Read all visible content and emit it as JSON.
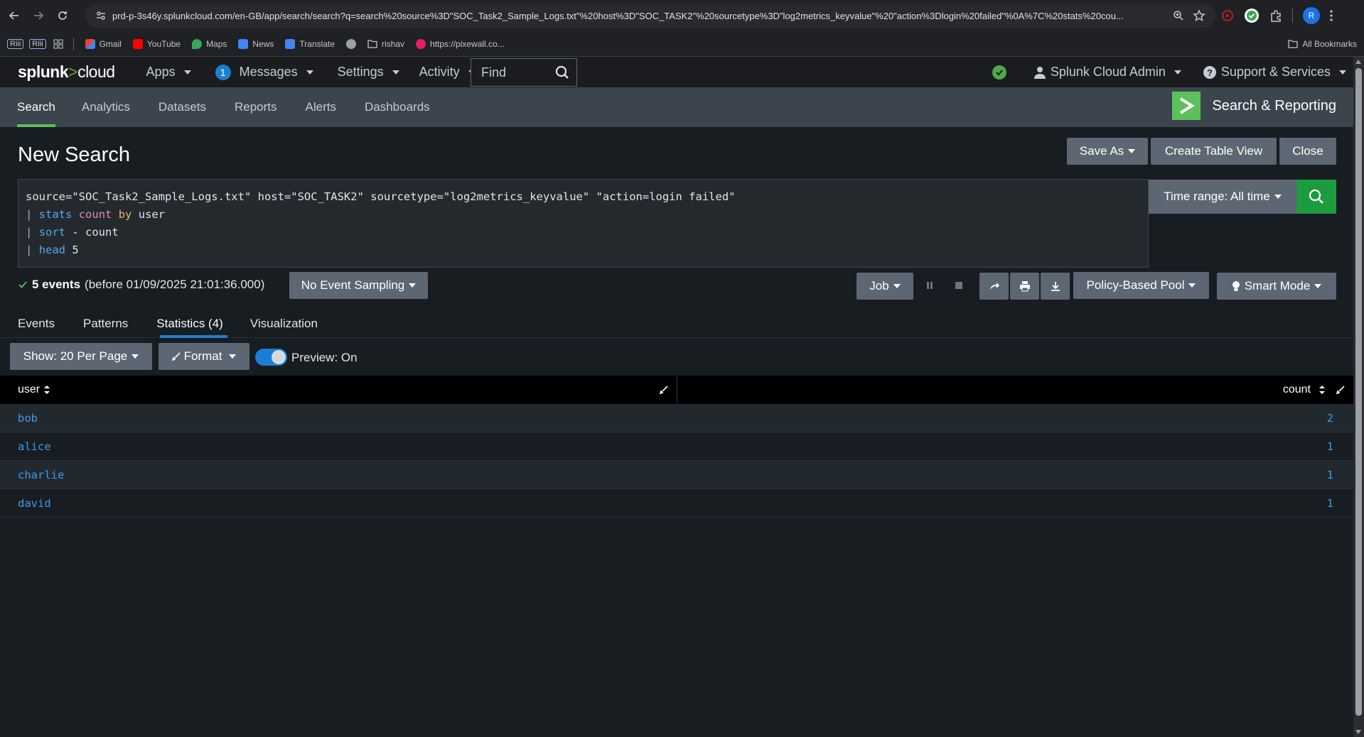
{
  "browser": {
    "url": "prd-p-3s46y.splunkcloud.com/en-GB/app/search/search?q=search%20source%3D\"SOC_Task2_Sample_Logs.txt\"%20host%3D\"SOC_TASK2\"%20sourcetype%3D\"log2metrics_keyvalue\"%20\"action%3Dlogin%20failed\"%0A%7C%20stats%20cou...",
    "profile_initial": "R",
    "bookmarks": [
      "Riii",
      "Riii",
      "Gmail",
      "YouTube",
      "Maps",
      "News",
      "Translate",
      "rishav",
      "https://pixewall.co..."
    ],
    "all_bookmarks": "All Bookmarks"
  },
  "splunk": {
    "logo_main": "splunk",
    "logo_gt": ">",
    "logo_cloud": "cloud",
    "menu": {
      "apps": "Apps",
      "messages_count": "1",
      "messages": "Messages",
      "settings": "Settings",
      "activity": "Activity",
      "find": "Find"
    },
    "user": "Splunk Cloud Admin",
    "support": "Support & Services"
  },
  "appbar": {
    "tabs": [
      "Search",
      "Analytics",
      "Datasets",
      "Reports",
      "Alerts",
      "Dashboards"
    ],
    "app_name": "Search & Reporting"
  },
  "page": {
    "title": "New Search",
    "save_as": "Save As",
    "create_table_view": "Create Table View",
    "close": "Close"
  },
  "search": {
    "line1": "source=\"SOC_Task2_Sample_Logs.txt\" host=\"SOC_TASK2\" sourcetype=\"log2metrics_keyvalue\" \"action=login failed\"",
    "line2_cmd": "stats",
    "line2_fn": "count",
    "line2_by": "by",
    "line2_field": "user",
    "line3_cmd": "sort",
    "line3_rest": "- count",
    "line4_cmd": "head",
    "line4_rest": "5",
    "pipe": "|",
    "time_range": "Time range: All time"
  },
  "status": {
    "events_bold": "5 events",
    "events_rest": "(before 01/09/2025 21:01:36.000)",
    "sampling": "No Event Sampling",
    "job": "Job",
    "pool": "Policy-Based Pool",
    "mode": "Smart Mode"
  },
  "result_tabs": [
    "Events",
    "Patterns",
    "Statistics (4)",
    "Visualization"
  ],
  "controls": {
    "per_page": "Show: 20 Per Page",
    "format": "Format",
    "preview": "Preview: On"
  },
  "table": {
    "columns": [
      "user",
      "count"
    ],
    "rows": [
      {
        "user": "bob",
        "count": "2"
      },
      {
        "user": "alice",
        "count": "1"
      },
      {
        "user": "charlie",
        "count": "1"
      },
      {
        "user": "david",
        "count": "1"
      }
    ]
  },
  "colors": {
    "accent_green": "#5cc05c",
    "accent_blue": "#1a7fd4",
    "search_button": "#1d9c3f"
  }
}
